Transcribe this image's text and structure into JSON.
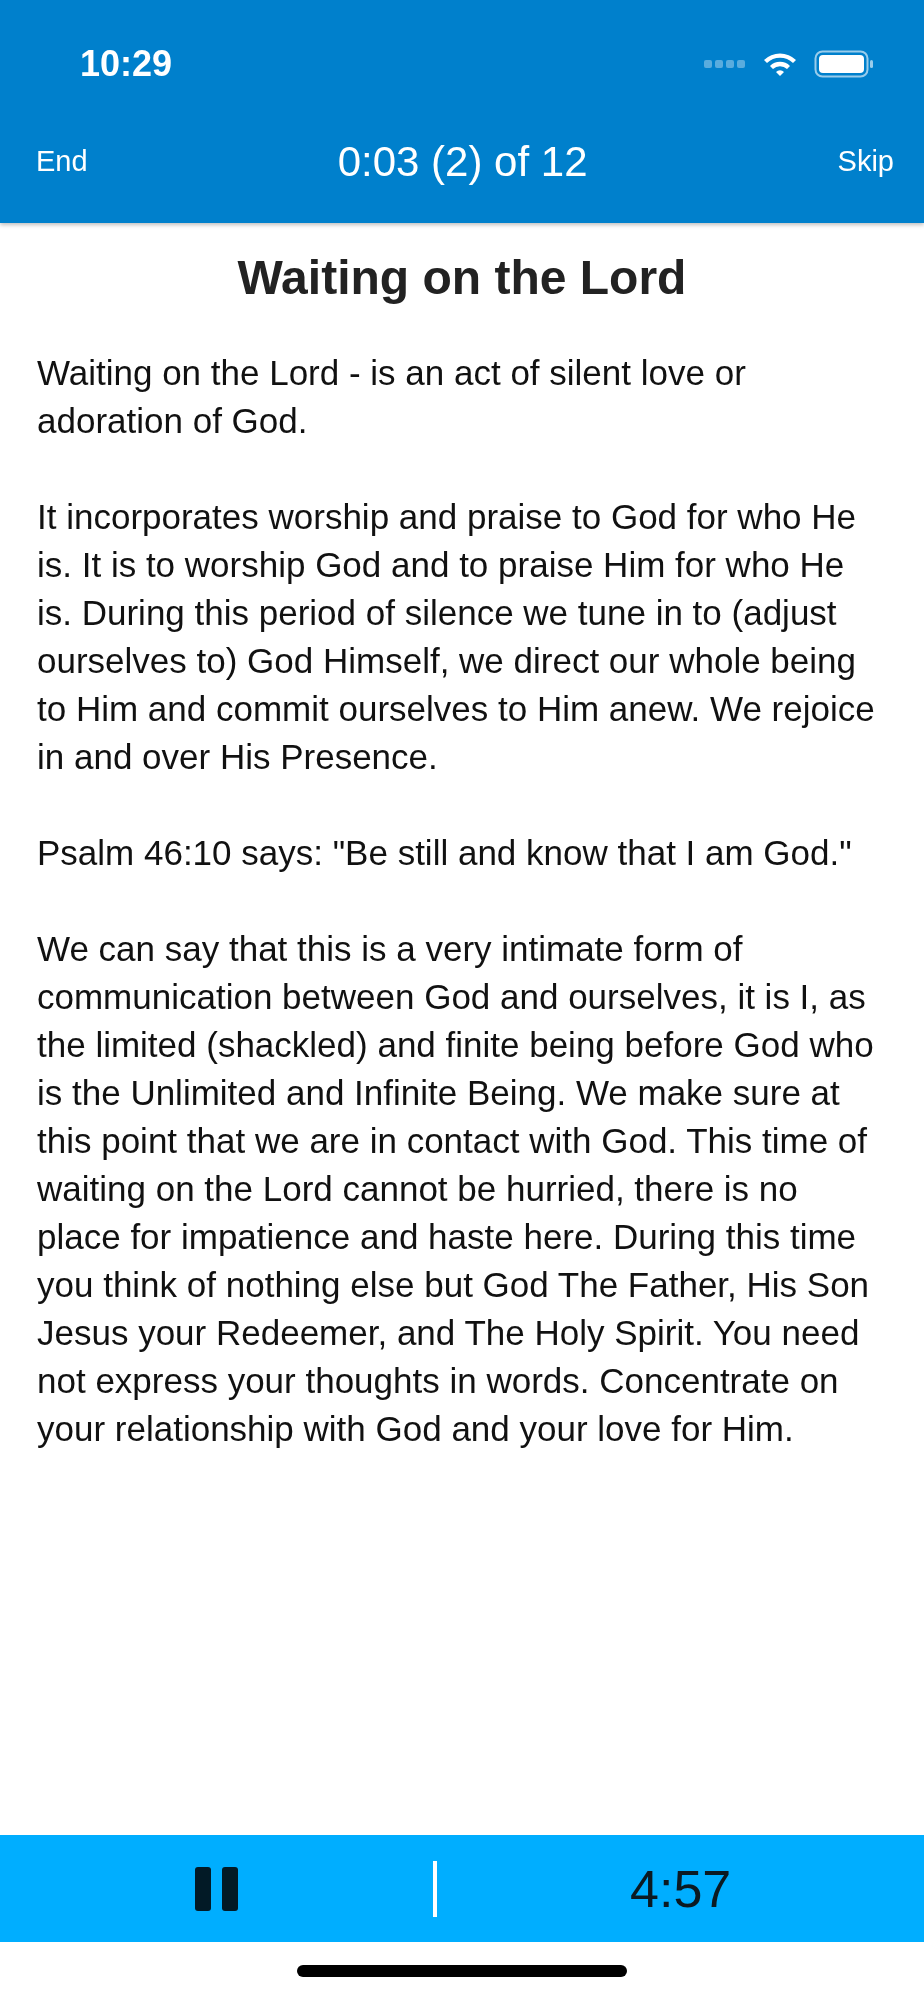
{
  "status_bar": {
    "time": "10:29"
  },
  "header": {
    "left_action": "End",
    "progress": "0:03 (2) of 12",
    "right_action": "Skip"
  },
  "title": "Waiting on the Lord",
  "paragraphs": [
    "Waiting on the Lord - is an act of silent love or adoration of God.",
    "It incorporates worship and praise to God for who He is. It is to worship God and to praise Him for who He is. During this period of silence we tune in to (adjust ourselves to) God Himself, we direct our whole being to Him and commit ourselves to Him anew. We rejoice in and over His Presence.",
    "Psalm 46:10 says: \"Be still and know that I am God.\"",
    "We can say that this is a very intimate form of communication between God and ourselves, it is I, as the limited (shackled) and finite being before God who is the Unlimited and Infinite Being. We make sure at this point that we are in contact with God. This time of waiting on the Lord cannot be hurried, there is no place for impatience and haste here. During this time you think of nothing else but God The Father, His Son Jesus your Redeemer, and The Holy Spirit. You need not express your thoughts in words. Concentrate on your relationship with God and your love for Him."
  ],
  "player": {
    "playing": true,
    "remaining": "4:57"
  }
}
